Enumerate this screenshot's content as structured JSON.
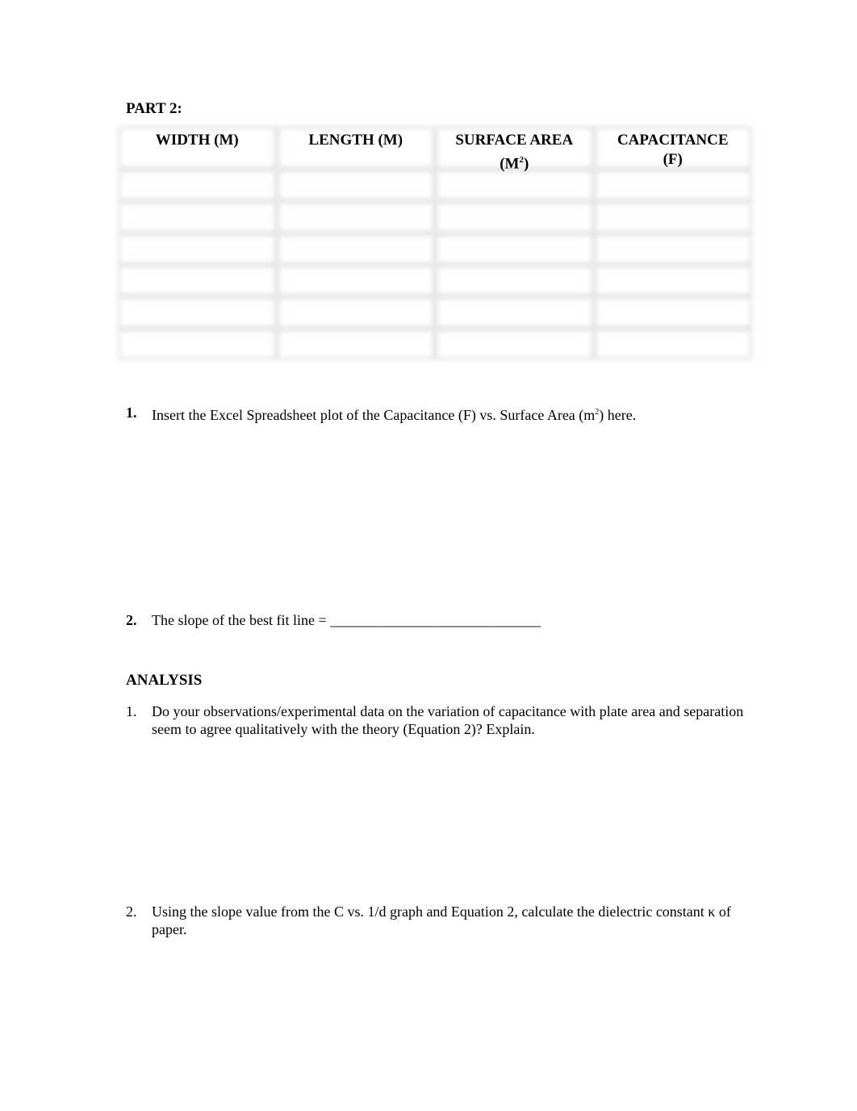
{
  "part": {
    "title": "PART 2:"
  },
  "table": {
    "headers": [
      {
        "main": "WIDTH (M)",
        "sub": ""
      },
      {
        "main": "LENGTH (M)",
        "sub": ""
      },
      {
        "main": "SURFACE AREA",
        "sub_prefix": "(M",
        "sub_sup": "2",
        "sub_suffix": ")"
      },
      {
        "main": "CAPACITANCE",
        "sub": "(F)"
      }
    ],
    "empty_rows": 6
  },
  "questions": [
    {
      "number": "1.",
      "text_before": "Insert the Excel Spreadsheet plot of the Capacitance (F) vs. Surface Area (m",
      "sup": "2",
      "text_after": ") here."
    },
    {
      "number": "2.",
      "text": "The slope of the best fit line = ",
      "blank": "_____________________________"
    }
  ],
  "analysis": {
    "title": "ANALYSIS",
    "items": [
      {
        "number": "1.",
        "text": "Do your observations/experimental data on the variation of capacitance with plate area and separation seem to agree qualitatively with the theory (Equation 2)? Explain."
      },
      {
        "number": "2.",
        "text": "Using the slope value from the C vs. 1/d graph and Equation 2, calculate the dielectric constant κ of paper."
      }
    ]
  }
}
